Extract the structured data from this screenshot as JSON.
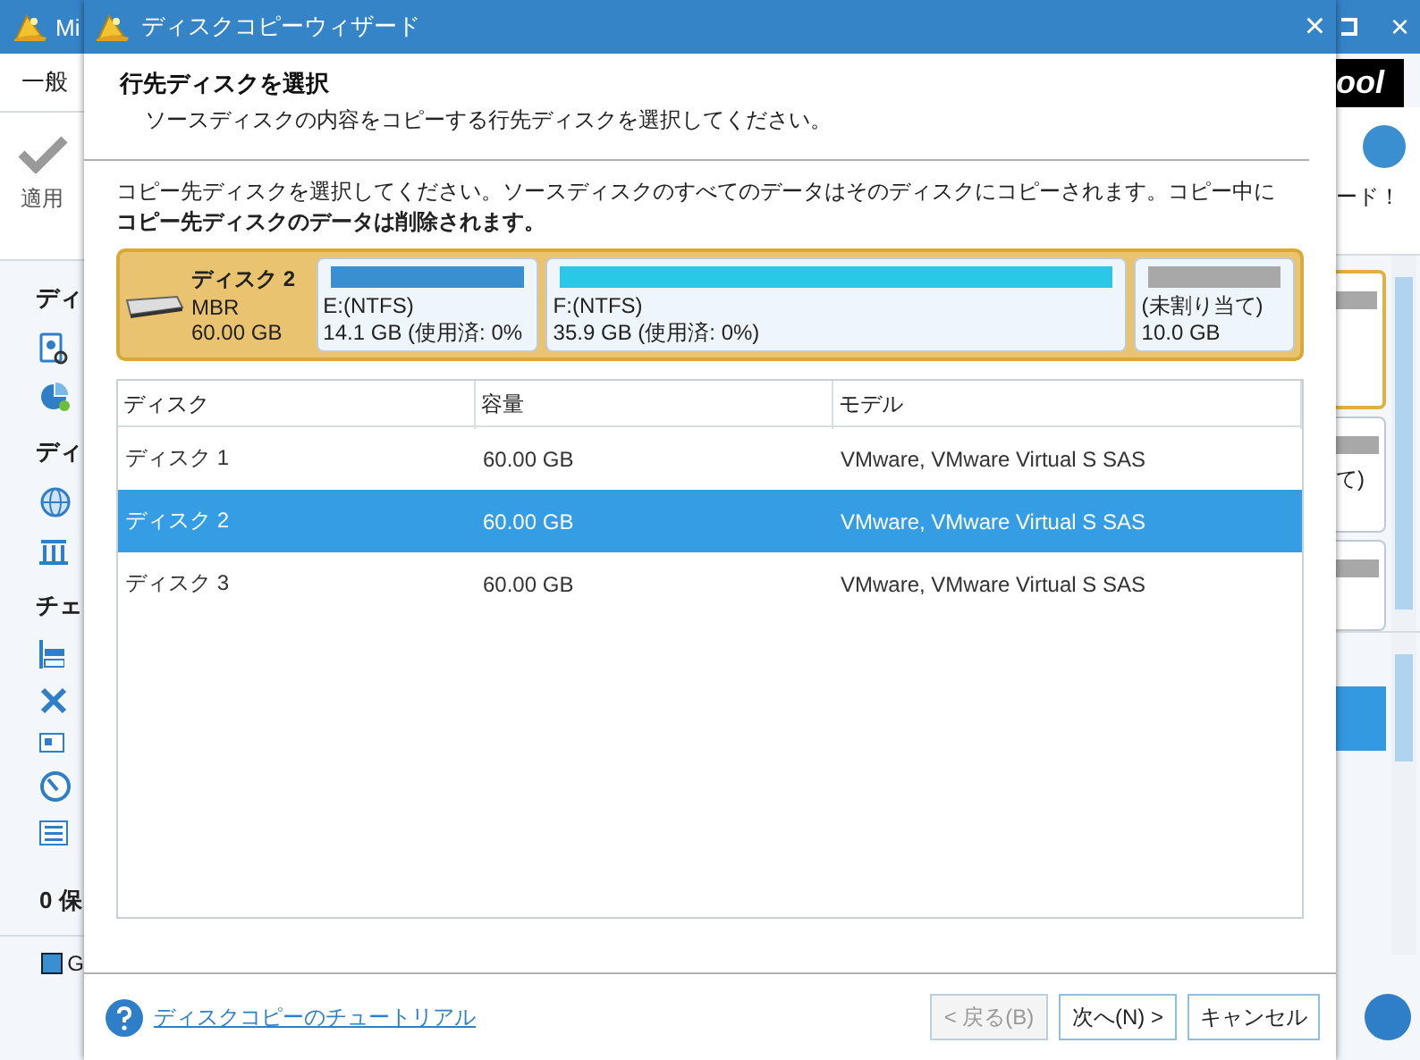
{
  "background_window": {
    "title": "Mi",
    "menu_tab": "一般",
    "toolbar_button": "適用",
    "sections": [
      {
        "label": "ディ"
      },
      {
        "label": "ディ"
      },
      {
        "label": "チェ"
      }
    ],
    "summary": "0 保",
    "legend": "G",
    "logo": "ool",
    "promo": "ード！",
    "card_text": "て)",
    "close": "×"
  },
  "dialog": {
    "title": "ディスクコピーウィザード",
    "close": "×",
    "heading": "行先ディスクを選択",
    "subheading": "ソースディスクの内容をコピーする行先ディスクを選択してください。",
    "instruction": "コピー先ディスクを選択してください。ソースディスクのすべてのデータはそのディスクにコピーされます。コピー中に**コピー先ディスクのデータは削除されます。**",
    "disk": {
      "name": "ディスク 2",
      "type": "MBR",
      "size": "60.00 GB"
    },
    "partitions": [
      {
        "label": "E:(NTFS)",
        "size": "14.1 GB (使用済: 0%",
        "color": "#3a8fd0"
      },
      {
        "label": "F:(NTFS)",
        "size": "35.9 GB (使用済: 0%)",
        "color": "#2ac8e6"
      },
      {
        "label": "(未割り当て)",
        "size": "10.0 GB",
        "color": "#a8a8a8"
      }
    ],
    "table": {
      "columns": [
        "ディスク",
        "容量",
        "モデル"
      ],
      "rows": [
        {
          "cells": [
            "ディスク 1",
            "60.00 GB",
            "VMware, VMware Virtual S SAS"
          ],
          "selected": false
        },
        {
          "cells": [
            "ディスク 2",
            "60.00 GB",
            "VMware, VMware Virtual S SAS"
          ],
          "selected": true
        },
        {
          "cells": [
            "ディスク 3",
            "60.00 GB",
            "VMware, VMware Virtual S SAS"
          ],
          "selected": false
        }
      ]
    },
    "help_link": "ディスクコピーのチュートリアル",
    "buttons": [
      {
        "label": "< 戻る(B)",
        "disabled": true
      },
      {
        "label": "次へ(N) >",
        "disabled": false
      },
      {
        "label": "キャンセル",
        "disabled": false
      }
    ]
  }
}
